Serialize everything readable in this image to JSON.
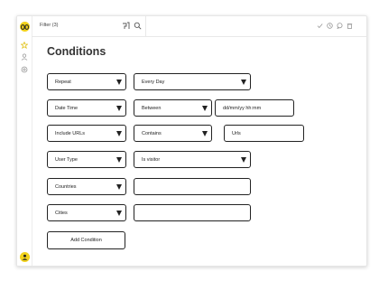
{
  "topbar": {
    "filename": "Filter (3)",
    "left_icons": [
      "paint-icon",
      "search-icon"
    ],
    "right_icons": [
      "check-icon",
      "history-icon",
      "comment-icon",
      "trash-icon"
    ]
  },
  "rail": {
    "logo": "logo-icon",
    "items": [
      "star-icon",
      "user-icon",
      "settings-icon"
    ],
    "avatar": "avatar-icon"
  },
  "page": {
    "title": "Conditions"
  },
  "conditions": [
    {
      "field": "Repeat",
      "value": "Every Day"
    },
    {
      "field": "Date Time",
      "operator": "Between",
      "input": "dd/mm/yy hh:mm"
    },
    {
      "field": "Include URLs",
      "operator": "Contains",
      "input": "Urls"
    },
    {
      "field": "User Type",
      "value": "Is visitor"
    },
    {
      "field": "Countries",
      "input": ""
    },
    {
      "field": "Cities",
      "input": ""
    }
  ],
  "actions": {
    "add_condition": "Add Condition"
  },
  "colors": {
    "accent": "#f2d21b",
    "border": "#222222"
  }
}
